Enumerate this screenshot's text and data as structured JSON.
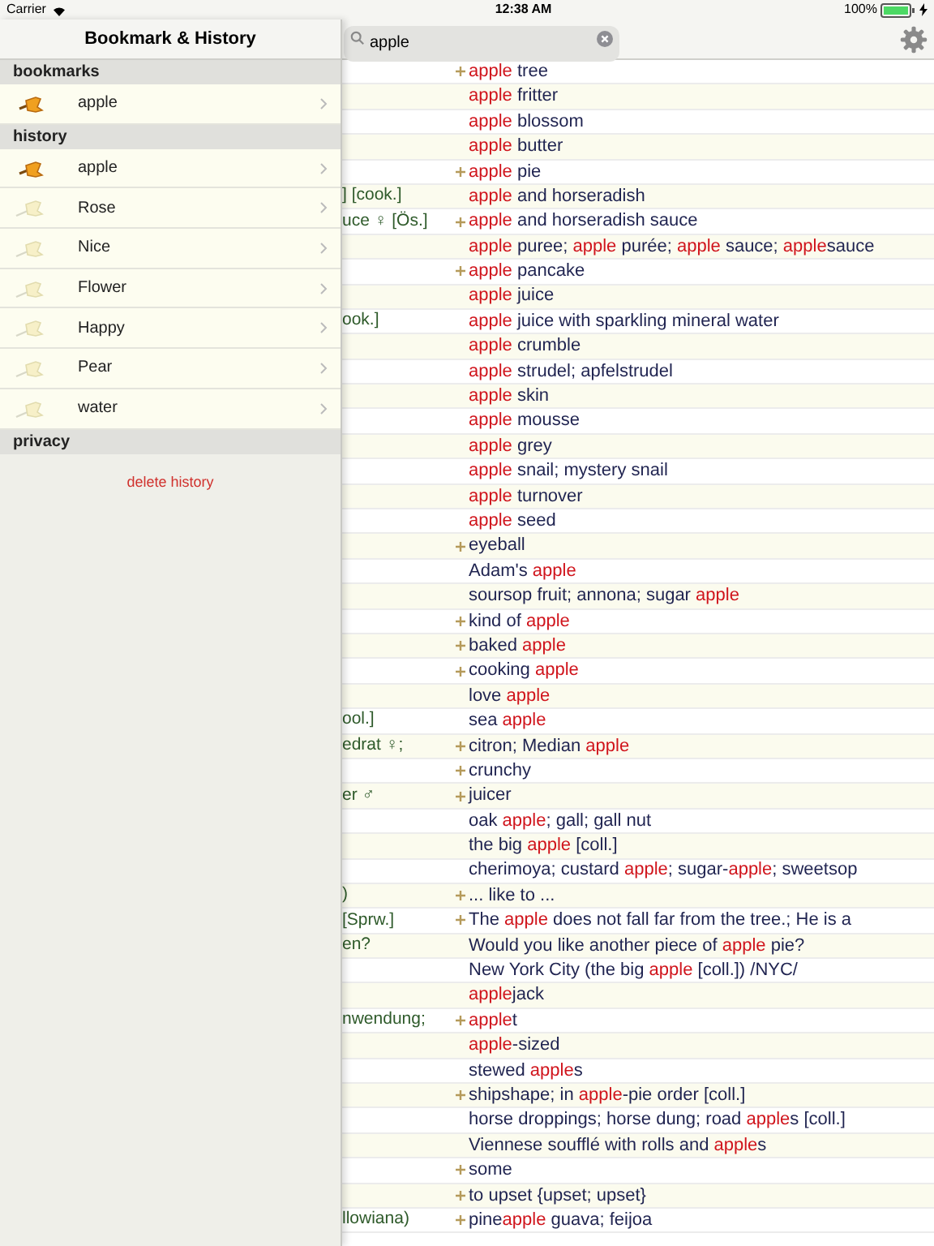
{
  "status_bar": {
    "carrier": "Carrier",
    "time": "12:38 AM",
    "battery": "100%"
  },
  "sidebar": {
    "title": "Bookmark & History",
    "sections": [
      {
        "title": "bookmarks",
        "items": [
          {
            "label": "apple",
            "bookmarked": true
          }
        ]
      },
      {
        "title": "history",
        "items": [
          {
            "label": "apple",
            "bookmarked": true
          },
          {
            "label": "Rose",
            "bookmarked": false
          },
          {
            "label": "Nice",
            "bookmarked": false
          },
          {
            "label": "Flower",
            "bookmarked": false
          },
          {
            "label": "Happy",
            "bookmarked": false
          },
          {
            "label": "Pear",
            "bookmarked": false
          },
          {
            "label": "water",
            "bookmarked": false
          }
        ]
      },
      {
        "title": "privacy",
        "action": "delete history"
      }
    ]
  },
  "search": {
    "value": "apple"
  },
  "results": [
    {
      "plus": true,
      "en": [
        {
          "t": "apple",
          "hit": true
        },
        {
          "t": " tree",
          "hit": false
        }
      ]
    },
    {
      "plus": false,
      "en": [
        {
          "t": "apple",
          "hit": true
        },
        {
          "t": " fritter",
          "hit": false
        }
      ]
    },
    {
      "plus": false,
      "en": [
        {
          "t": "apple",
          "hit": true
        },
        {
          "t": " blossom",
          "hit": false
        }
      ]
    },
    {
      "plus": false,
      "en": [
        {
          "t": "apple",
          "hit": true
        },
        {
          "t": " butter",
          "hit": false
        }
      ]
    },
    {
      "plus": true,
      "en": [
        {
          "t": "apple",
          "hit": true
        },
        {
          "t": " pie",
          "hit": false
        }
      ]
    },
    {
      "plus": false,
      "de": "] [cook.]",
      "en": [
        {
          "t": "apple",
          "hit": true
        },
        {
          "t": " and horseradish",
          "hit": false
        }
      ]
    },
    {
      "plus": true,
      "de": "uce ♀  [Ös.]",
      "en": [
        {
          "t": "apple",
          "hit": true
        },
        {
          "t": " and horseradish sauce",
          "hit": false
        }
      ]
    },
    {
      "plus": false,
      "en": [
        {
          "t": "apple",
          "hit": true
        },
        {
          "t": " puree; ",
          "hit": false
        },
        {
          "t": "apple",
          "hit": true
        },
        {
          "t": " purée; ",
          "hit": false
        },
        {
          "t": "apple",
          "hit": true
        },
        {
          "t": " sauce; ",
          "hit": false
        },
        {
          "t": "apple",
          "hit": true
        },
        {
          "t": "sauce",
          "hit": false
        }
      ]
    },
    {
      "plus": true,
      "en": [
        {
          "t": "apple",
          "hit": true
        },
        {
          "t": " pancake",
          "hit": false
        }
      ]
    },
    {
      "plus": false,
      "en": [
        {
          "t": "apple",
          "hit": true
        },
        {
          "t": " juice",
          "hit": false
        }
      ]
    },
    {
      "plus": false,
      "de": "ook.]",
      "en": [
        {
          "t": "apple",
          "hit": true
        },
        {
          "t": " juice with sparkling mineral water",
          "hit": false
        }
      ]
    },
    {
      "plus": false,
      "en": [
        {
          "t": "apple",
          "hit": true
        },
        {
          "t": " crumble",
          "hit": false
        }
      ]
    },
    {
      "plus": false,
      "en": [
        {
          "t": "apple",
          "hit": true
        },
        {
          "t": " strudel; apfelstrudel",
          "hit": false
        }
      ]
    },
    {
      "plus": false,
      "en": [
        {
          "t": "apple",
          "hit": true
        },
        {
          "t": " skin",
          "hit": false
        }
      ]
    },
    {
      "plus": false,
      "en": [
        {
          "t": "apple",
          "hit": true
        },
        {
          "t": " mousse",
          "hit": false
        }
      ]
    },
    {
      "plus": false,
      "en": [
        {
          "t": "apple",
          "hit": true
        },
        {
          "t": " grey",
          "hit": false
        }
      ]
    },
    {
      "plus": false,
      "en": [
        {
          "t": "apple",
          "hit": true
        },
        {
          "t": " snail; mystery snail",
          "hit": false
        }
      ]
    },
    {
      "plus": false,
      "en": [
        {
          "t": "apple",
          "hit": true
        },
        {
          "t": " turnover",
          "hit": false
        }
      ]
    },
    {
      "plus": false,
      "en": [
        {
          "t": "apple",
          "hit": true
        },
        {
          "t": " seed",
          "hit": false
        }
      ]
    },
    {
      "plus": true,
      "en": [
        {
          "t": "eyeball",
          "hit": false
        }
      ]
    },
    {
      "plus": false,
      "en": [
        {
          "t": "Adam's ",
          "hit": false
        },
        {
          "t": "apple",
          "hit": true
        }
      ]
    },
    {
      "plus": false,
      "en": [
        {
          "t": "soursop fruit; annona; sugar ",
          "hit": false
        },
        {
          "t": "apple",
          "hit": true
        }
      ]
    },
    {
      "plus": true,
      "en": [
        {
          "t": "kind of ",
          "hit": false
        },
        {
          "t": "apple",
          "hit": true
        }
      ]
    },
    {
      "plus": true,
      "en": [
        {
          "t": "baked ",
          "hit": false
        },
        {
          "t": "apple",
          "hit": true
        }
      ]
    },
    {
      "plus": true,
      "en": [
        {
          "t": "cooking ",
          "hit": false
        },
        {
          "t": "apple",
          "hit": true
        }
      ]
    },
    {
      "plus": false,
      "en": [
        {
          "t": "love ",
          "hit": false
        },
        {
          "t": "apple",
          "hit": true
        }
      ]
    },
    {
      "plus": false,
      "de": "ool.]",
      "en": [
        {
          "t": "sea ",
          "hit": false
        },
        {
          "t": "apple",
          "hit": true
        }
      ]
    },
    {
      "plus": true,
      "de": "edrat ♀;",
      "en": [
        {
          "t": "citron; Median ",
          "hit": false
        },
        {
          "t": "apple",
          "hit": true
        }
      ]
    },
    {
      "plus": true,
      "en": [
        {
          "t": "crunchy",
          "hit": false
        }
      ]
    },
    {
      "plus": true,
      "de": "er ♂",
      "en": [
        {
          "t": "juicer",
          "hit": false
        }
      ]
    },
    {
      "plus": false,
      "en": [
        {
          "t": "oak ",
          "hit": false
        },
        {
          "t": "apple",
          "hit": true
        },
        {
          "t": "; gall; gall nut",
          "hit": false
        }
      ]
    },
    {
      "plus": false,
      "en": [
        {
          "t": "the big ",
          "hit": false
        },
        {
          "t": "apple",
          "hit": true
        },
        {
          "t": " [coll.]",
          "hit": false
        }
      ]
    },
    {
      "plus": false,
      "en": [
        {
          "t": "cherimoya; custard ",
          "hit": false
        },
        {
          "t": "apple",
          "hit": true
        },
        {
          "t": "; sugar-",
          "hit": false
        },
        {
          "t": "apple",
          "hit": true
        },
        {
          "t": "; sweetsop",
          "hit": false
        }
      ]
    },
    {
      "plus": true,
      "de": ")",
      "en": [
        {
          "t": "... like to ...",
          "hit": false
        }
      ]
    },
    {
      "plus": true,
      "de": "[Sprw.]",
      "en": [
        {
          "t": "The ",
          "hit": false
        },
        {
          "t": "apple",
          "hit": true
        },
        {
          "t": " does not fall far from the tree.; He is a",
          "hit": false
        }
      ]
    },
    {
      "plus": false,
      "de": "en?",
      "en": [
        {
          "t": "Would you like another piece of ",
          "hit": false
        },
        {
          "t": "apple",
          "hit": true
        },
        {
          "t": " pie?",
          "hit": false
        }
      ]
    },
    {
      "plus": false,
      "en": [
        {
          "t": "New York City (the big ",
          "hit": false
        },
        {
          "t": "apple",
          "hit": true
        },
        {
          "t": " [coll.]) /NYC/",
          "hit": false
        }
      ]
    },
    {
      "plus": false,
      "en": [
        {
          "t": "apple",
          "hit": true
        },
        {
          "t": "jack",
          "hit": false
        }
      ]
    },
    {
      "plus": true,
      "de": "nwendung;",
      "en": [
        {
          "t": "apple",
          "hit": true
        },
        {
          "t": "t",
          "hit": false
        }
      ]
    },
    {
      "plus": false,
      "en": [
        {
          "t": "apple",
          "hit": true
        },
        {
          "t": "-sized",
          "hit": false
        }
      ]
    },
    {
      "plus": false,
      "en": [
        {
          "t": "stewed ",
          "hit": false
        },
        {
          "t": "apple",
          "hit": true
        },
        {
          "t": "s",
          "hit": false
        }
      ]
    },
    {
      "plus": true,
      "en": [
        {
          "t": "shipshape; in ",
          "hit": false
        },
        {
          "t": "apple",
          "hit": true
        },
        {
          "t": "-pie order [coll.]",
          "hit": false
        }
      ]
    },
    {
      "plus": false,
      "en": [
        {
          "t": "horse droppings; horse dung; road ",
          "hit": false
        },
        {
          "t": "apple",
          "hit": true
        },
        {
          "t": "s [coll.]",
          "hit": false
        }
      ]
    },
    {
      "plus": false,
      "en": [
        {
          "t": "Viennese soufflé with rolls and ",
          "hit": false
        },
        {
          "t": "apple",
          "hit": true
        },
        {
          "t": "s",
          "hit": false
        }
      ]
    },
    {
      "plus": true,
      "en": [
        {
          "t": "some",
          "hit": false
        }
      ]
    },
    {
      "plus": true,
      "en": [
        {
          "t": "to upset {upset; upset}",
          "hit": false
        }
      ]
    },
    {
      "plus": true,
      "de": "llowiana)",
      "en": [
        {
          "t": "pine",
          "hit": false
        },
        {
          "t": "apple",
          "hit": true
        },
        {
          "t": " guava; feijoa",
          "hit": false
        }
      ]
    }
  ]
}
